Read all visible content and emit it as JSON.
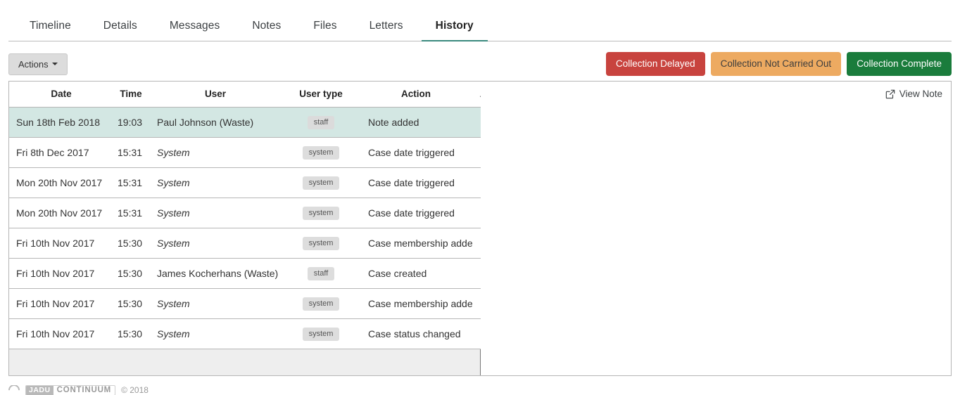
{
  "tabs": [
    {
      "label": "Timeline",
      "active": false
    },
    {
      "label": "Details",
      "active": false
    },
    {
      "label": "Messages",
      "active": false
    },
    {
      "label": "Notes",
      "active": false
    },
    {
      "label": "Files",
      "active": false
    },
    {
      "label": "Letters",
      "active": false
    },
    {
      "label": "History",
      "active": true
    }
  ],
  "toolbar": {
    "actions_label": "Actions",
    "status_buttons": [
      {
        "label": "Collection Delayed",
        "color": "#c8433e",
        "variant": "delayed"
      },
      {
        "label": "Collection Not Carried Out",
        "color": "#edaa61",
        "variant": "notcarried"
      },
      {
        "label": "Collection Complete",
        "color": "#1a7c3c",
        "variant": "complete"
      }
    ]
  },
  "table": {
    "columns": [
      "Date",
      "Time",
      "User",
      "User type",
      "Action",
      "Alerts"
    ],
    "rows": [
      {
        "date": "Sun 18th Feb 2018",
        "time": "19:03",
        "user": "Paul Johnson (Waste)",
        "user_italic": false,
        "user_type": "staff",
        "action": "Note added",
        "alerts": "",
        "highlighted": true
      },
      {
        "date": "Fri 8th Dec 2017",
        "time": "15:31",
        "user": "System",
        "user_italic": true,
        "user_type": "system",
        "action": "Case date triggered",
        "alerts": "",
        "highlighted": false
      },
      {
        "date": "Mon 20th Nov 2017",
        "time": "15:31",
        "user": "System",
        "user_italic": true,
        "user_type": "system",
        "action": "Case date triggered",
        "alerts": "",
        "highlighted": false
      },
      {
        "date": "Mon 20th Nov 2017",
        "time": "15:31",
        "user": "System",
        "user_italic": true,
        "user_type": "system",
        "action": "Case date triggered",
        "alerts": "",
        "highlighted": false
      },
      {
        "date": "Fri 10th Nov 2017",
        "time": "15:30",
        "user": "System",
        "user_italic": true,
        "user_type": "system",
        "action": "Case membership added",
        "alerts": "",
        "highlighted": false
      },
      {
        "date": "Fri 10th Nov 2017",
        "time": "15:30",
        "user": "James Kocherhans (Waste)",
        "user_italic": false,
        "user_type": "staff",
        "action": "Case created",
        "alerts": "",
        "highlighted": false
      },
      {
        "date": "Fri 10th Nov 2017",
        "time": "15:30",
        "user": "System",
        "user_italic": true,
        "user_type": "system",
        "action": "Case membership added",
        "alerts": "",
        "highlighted": false
      },
      {
        "date": "Fri 10th Nov 2017",
        "time": "15:30",
        "user": "System",
        "user_italic": true,
        "user_type": "system",
        "action": "Case status changed",
        "alerts": "",
        "highlighted": false
      }
    ]
  },
  "detail_panel": {
    "view_note_label": "View Note",
    "view_note_icon": "external-link-icon"
  },
  "footer": {
    "logo_primary": "JADU",
    "logo_secondary": "CONTINUUM",
    "copyright": "© 2018"
  },
  "colors": {
    "accent_teal": "#3a8a7e",
    "row_highlight": "#d3e7e3",
    "panel_border": "#b6b6b6",
    "badge_bg": "#dddddd"
  }
}
